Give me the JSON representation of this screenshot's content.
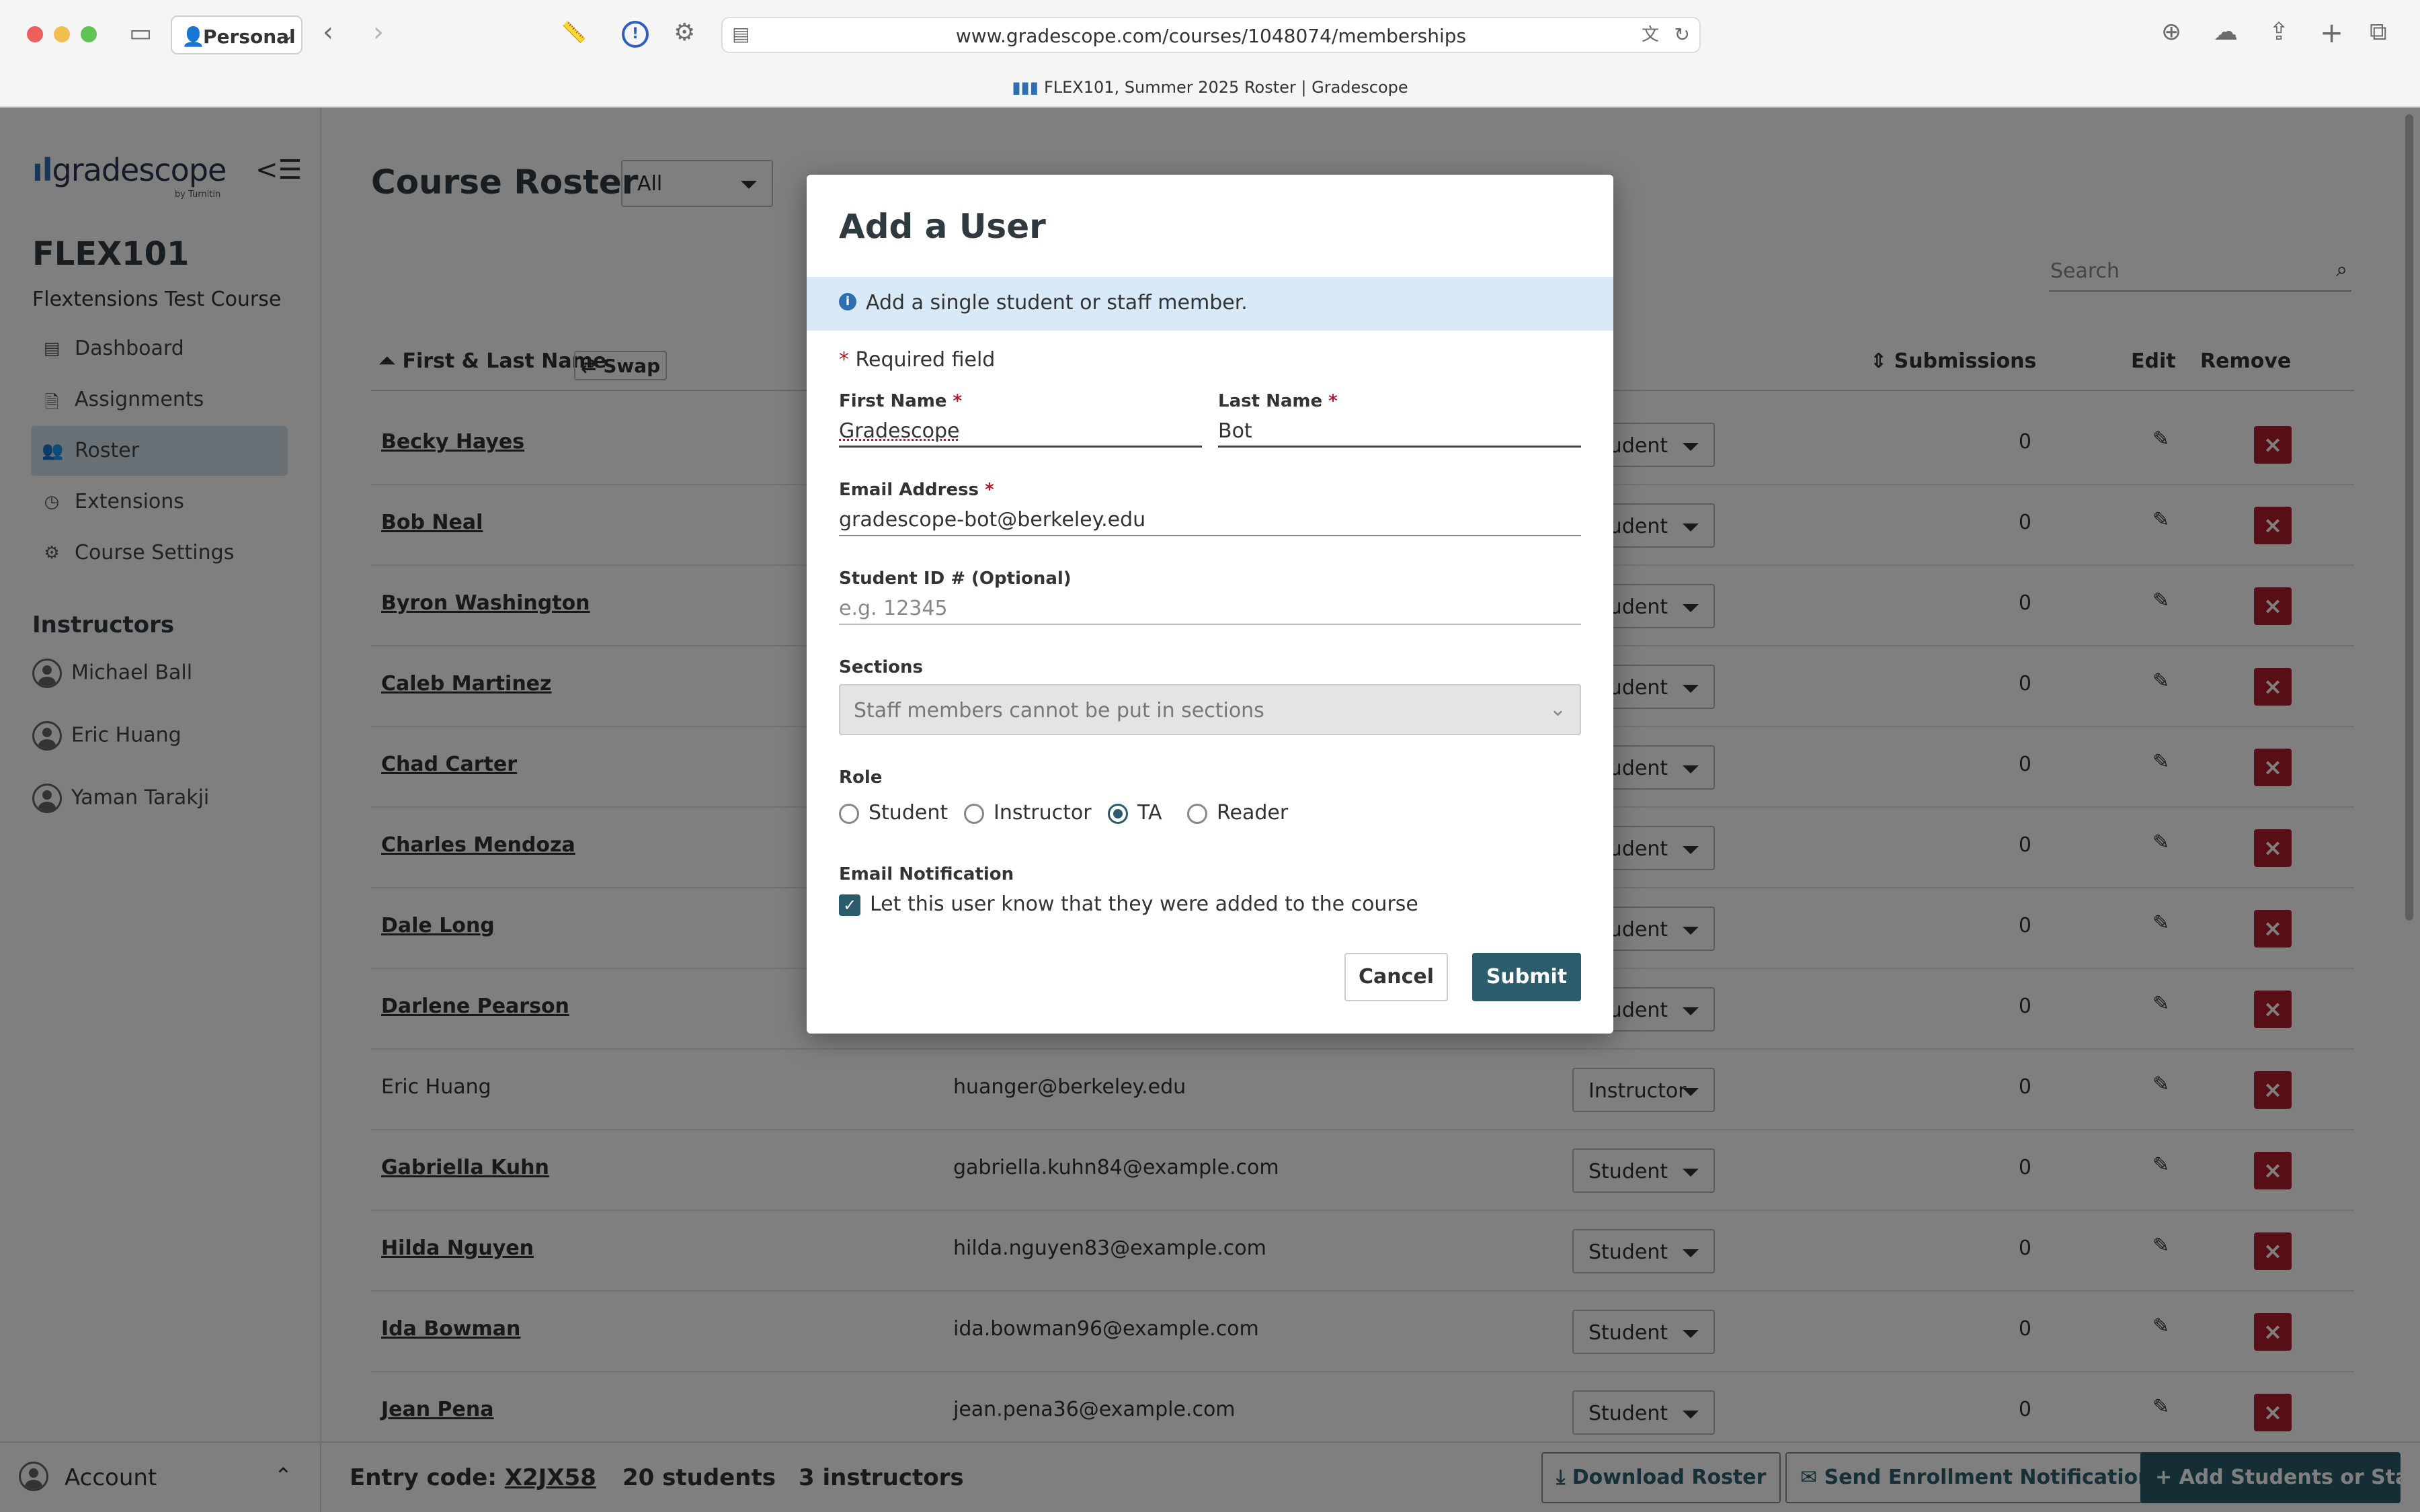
{
  "browser": {
    "profile": "Personal",
    "url": "www.gradescope.com/courses/1048074/memberships",
    "tab_title": "FLEX101, Summer 2025 Roster | Gradescope"
  },
  "sidebar": {
    "logo_text": "gradescope",
    "logo_sub": "by Turnitin",
    "course_code": "FLEX101",
    "course_name": "Flextensions Test Course",
    "nav": [
      {
        "label": "Dashboard",
        "icon": "dashboard-icon"
      },
      {
        "label": "Assignments",
        "icon": "document-icon"
      },
      {
        "label": "Roster",
        "icon": "users-icon"
      },
      {
        "label": "Extensions",
        "icon": "clock-icon"
      },
      {
        "label": "Course Settings",
        "icon": "gear-icon"
      }
    ],
    "instructors_heading": "Instructors",
    "instructors": [
      "Michael Ball",
      "Eric Huang",
      "Yaman Tarakji"
    ],
    "account_label": "Account"
  },
  "main": {
    "title": "Course Roster",
    "filter_value": "All",
    "search_placeholder": "Search",
    "columns": {
      "name": "First & Last Name",
      "swap": "Swap",
      "submissions": "Submissions",
      "edit": "Edit",
      "remove": "Remove"
    },
    "rows": [
      {
        "name": "Becky Hayes",
        "email": "",
        "role": "Student",
        "submissions": "0",
        "link": true
      },
      {
        "name": "Bob Neal",
        "email": "",
        "role": "Student",
        "submissions": "0",
        "link": true
      },
      {
        "name": "Byron Washington",
        "email": "",
        "role": "Student",
        "submissions": "0",
        "link": true
      },
      {
        "name": "Caleb Martinez",
        "email": "",
        "role": "Student",
        "submissions": "0",
        "link": true
      },
      {
        "name": "Chad Carter",
        "email": "",
        "role": "Student",
        "submissions": "0",
        "link": true
      },
      {
        "name": "Charles Mendoza",
        "email": "",
        "role": "Student",
        "submissions": "0",
        "link": true
      },
      {
        "name": "Dale Long",
        "email": "",
        "role": "Student",
        "submissions": "0",
        "link": true
      },
      {
        "name": "Darlene Pearson",
        "email": "",
        "role": "Student",
        "submissions": "0",
        "link": true
      },
      {
        "name": "Eric Huang",
        "email": "huanger@berkeley.edu",
        "role": "Instructor",
        "submissions": "0",
        "link": false
      },
      {
        "name": "Gabriella Kuhn",
        "email": "gabriella.kuhn84@example.com",
        "role": "Student",
        "submissions": "0",
        "link": true
      },
      {
        "name": "Hilda Nguyen",
        "email": "hilda.nguyen83@example.com",
        "role": "Student",
        "submissions": "0",
        "link": true
      },
      {
        "name": "Ida Bowman",
        "email": "ida.bowman96@example.com",
        "role": "Student",
        "submissions": "0",
        "link": true
      },
      {
        "name": "Jean Pena",
        "email": "jean.pena36@example.com",
        "role": "Student",
        "submissions": "0",
        "link": true
      }
    ]
  },
  "footer": {
    "entry_code_label": "Entry code:",
    "entry_code": "X2JX58",
    "students": "20 students",
    "instructors": "3 instructors",
    "download_button": "Download Roster",
    "notify_button": "Send Enrollment Notification",
    "add_button": "Add Students or Staff"
  },
  "modal": {
    "title": "Add a User",
    "info": "Add a single student or staff member.",
    "required_note": "Required field",
    "first_name_label": "First Name",
    "first_name_value": "Gradescope",
    "last_name_label": "Last Name",
    "last_name_value": "Bot",
    "email_label": "Email Address",
    "email_value": "gradescope-bot@berkeley.edu",
    "student_id_label": "Student ID # (Optional)",
    "student_id_placeholder": "e.g. 12345",
    "sections_label": "Sections",
    "sections_value": "Staff members cannot be put in sections",
    "role_label": "Role",
    "roles": [
      "Student",
      "Instructor",
      "TA",
      "Reader"
    ],
    "selected_role": "TA",
    "notification_label": "Email Notification",
    "notification_text": "Let this user know that they were added to the course",
    "notification_checked": true,
    "cancel_button": "Cancel",
    "submit_button": "Submit"
  },
  "colors": {
    "accent": "#2b5c6b",
    "danger": "#b21f2d",
    "info_bg": "#d8eaf7"
  }
}
